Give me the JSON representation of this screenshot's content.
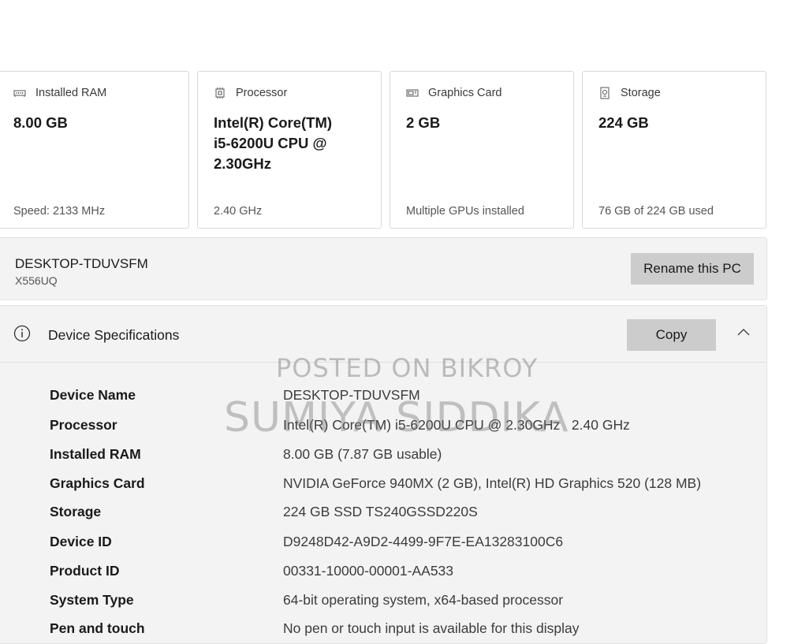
{
  "cards": [
    {
      "label": "Installed RAM",
      "value": "8.00 GB",
      "foot": "Speed: 2133 MHz",
      "icon": "ram-icon"
    },
    {
      "label": "Processor",
      "value": "Intel(R) Core(TM) i5-6200U CPU @ 2.30GHz",
      "foot": "2.40 GHz",
      "icon": "processor-icon"
    },
    {
      "label": "Graphics Card",
      "value": "2 GB",
      "foot": "Multiple GPUs installed",
      "icon": "graphics-card-icon"
    },
    {
      "label": "Storage",
      "value": "224 GB",
      "foot": "76 GB of 224 GB used",
      "icon": "storage-icon"
    }
  ],
  "pc": {
    "name": "DESKTOP-TDUVSFM",
    "model": "X556UQ",
    "rename_label": "Rename this PC"
  },
  "specs": {
    "title": "Device Specifications",
    "copy_label": "Copy",
    "rows": [
      {
        "key": "Device Name",
        "value": "DESKTOP-TDUVSFM"
      },
      {
        "key": "Processor",
        "value": "Intel(R) Core(TM) i5-6200U CPU @ 2.30GHz   2.40 GHz"
      },
      {
        "key": "Installed RAM",
        "value": "8.00 GB (7.87 GB usable)"
      },
      {
        "key": "Graphics Card",
        "value": "NVIDIA GeForce 940MX (2 GB), Intel(R) HD Graphics 520 (128 MB)"
      },
      {
        "key": "Storage",
        "value": "224 GB SSD TS240GSSD220S"
      },
      {
        "key": "Device ID",
        "value": "D9248D42-A9D2-4499-9F7E-EA13283100C6"
      },
      {
        "key": "Product ID",
        "value": "00331-10000-00001-AA533"
      },
      {
        "key": "System Type",
        "value": "64-bit operating system, x64-based processor"
      },
      {
        "key": "Pen and touch",
        "value": "No pen or touch input is available for this display"
      }
    ]
  },
  "watermark": {
    "line1": "POSTED ON BIKROY",
    "line2": "SUMIYA SIDDIKA"
  }
}
